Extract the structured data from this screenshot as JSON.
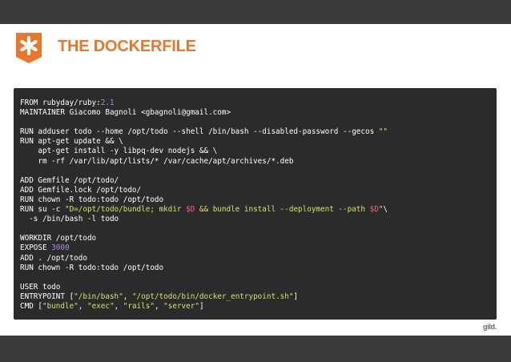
{
  "slide": {
    "title": "THE DOCKERFILE",
    "logo_icon": "asterisk-badge-icon",
    "brand_text": "gild."
  },
  "colors": {
    "accent": "#e8762c",
    "bar": "#3b3b3b",
    "code_bg": "#2b2b2b",
    "code_text": "#ffffff",
    "number": "#a98bd6",
    "string": "#d8e06a",
    "variable": "#ff5a8a"
  },
  "code": {
    "lines": [
      [
        {
          "t": "FROM rubyday/ruby:"
        },
        {
          "t": "2.1",
          "c": "num"
        }
      ],
      [
        {
          "t": "MAINTAINER Giacomo Bagnoli <gbagnoli@gmail.com>"
        }
      ],
      [
        {
          "t": ""
        }
      ],
      [
        {
          "t": "RUN adduser todo --home /opt/todo --shell /bin/bash --disabled-password --gecos "
        },
        {
          "t": "\"\"",
          "c": "str"
        }
      ],
      [
        {
          "t": "RUN apt-get update && \\"
        }
      ],
      [
        {
          "t": "    apt-get install -y libpq-dev nodejs && \\"
        }
      ],
      [
        {
          "t": "    rm -rf /var/lib/apt/lists/* /var/cache/apt/archives/*.deb"
        }
      ],
      [
        {
          "t": ""
        }
      ],
      [
        {
          "t": "ADD Gemfile /opt/todo/"
        }
      ],
      [
        {
          "t": "ADD Gemfile.lock /opt/todo/"
        }
      ],
      [
        {
          "t": "RUN chown -R todo:todo /opt/todo"
        }
      ],
      [
        {
          "t": "RUN su -c "
        },
        {
          "t": "\"D=/opt/todo/bundle; mkdir ",
          "c": "str"
        },
        {
          "t": "$D",
          "c": "var"
        },
        {
          "t": " && bundle install --deployment --path ",
          "c": "str"
        },
        {
          "t": "$D",
          "c": "var"
        },
        {
          "t": "\"",
          "c": "str"
        },
        {
          "t": "\\"
        }
      ],
      [
        {
          "t": "  -s /bin/bash -l todo"
        }
      ],
      [
        {
          "t": ""
        }
      ],
      [
        {
          "t": "WORKDIR /opt/todo"
        }
      ],
      [
        {
          "t": "EXPOSE "
        },
        {
          "t": "3000",
          "c": "num"
        }
      ],
      [
        {
          "t": "ADD . /opt/todo"
        }
      ],
      [
        {
          "t": "RUN chown -R todo:todo /opt/todo"
        }
      ],
      [
        {
          "t": ""
        }
      ],
      [
        {
          "t": "USER todo"
        }
      ],
      [
        {
          "t": "ENTRYPOINT ["
        },
        {
          "t": "\"/bin/bash\"",
          "c": "str"
        },
        {
          "t": ", "
        },
        {
          "t": "\"/opt/todo/bin/docker_entrypoint.sh\"",
          "c": "str"
        },
        {
          "t": "]"
        }
      ],
      [
        {
          "t": "CMD ["
        },
        {
          "t": "\"bundle\"",
          "c": "str"
        },
        {
          "t": ", "
        },
        {
          "t": "\"exec\"",
          "c": "str"
        },
        {
          "t": ", "
        },
        {
          "t": "\"rails\"",
          "c": "str"
        },
        {
          "t": ", "
        },
        {
          "t": "\"server\"",
          "c": "str"
        },
        {
          "t": "]"
        }
      ]
    ]
  }
}
